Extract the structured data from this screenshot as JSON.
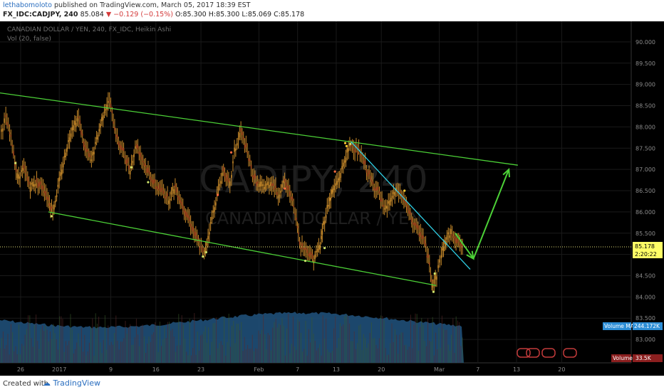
{
  "header": {
    "author": "lethabomoloto",
    "published_text": "published on TradingView.com, March 05, 2017 18:39 EST",
    "symbol": "FX_IDC:CADJPY, 240",
    "last": "85.084",
    "change": "−0.129 (−0.15%)",
    "ohlc": "O:85.300 H:85.300 L:85.069 C:85.178"
  },
  "chart_data": {
    "type": "line",
    "title": "CANADIAN DOLLAR / YEN, 240, FX_IDC, Heikin Ashi",
    "subtitle": "Vol (20, false)",
    "watermark": "CADJPY, 240",
    "watermark_sub": "CANADIAN DOLLAR / YEN",
    "ylim": [
      82.55,
      90.25
    ],
    "yticks": [
      "83.000",
      "83.500",
      "84.000",
      "84.500",
      "85.000",
      "85.500",
      "86.000",
      "86.500",
      "87.000",
      "87.500",
      "88.000",
      "88.500",
      "89.000",
      "89.500",
      "90.000"
    ],
    "xticks": [
      {
        "label": "26",
        "day": -6
      },
      {
        "label": "2017",
        "day": 0
      },
      {
        "label": "9",
        "day": 8
      },
      {
        "label": "16",
        "day": 15
      },
      {
        "label": "23",
        "day": 22
      },
      {
        "label": "Feb",
        "day": 31
      },
      {
        "label": "7",
        "day": 37
      },
      {
        "label": "13",
        "day": 43
      },
      {
        "label": "20",
        "day": 50
      },
      {
        "label": "Mar",
        "day": 59
      },
      {
        "label": "7",
        "day": 65
      },
      {
        "label": "13",
        "day": 71
      },
      {
        "label": "20",
        "day": 78
      }
    ],
    "xlim_days": [
      -9.2,
      88.8
    ],
    "price_path": [
      [
        -9,
        87.9
      ],
      [
        -8.3,
        88.2
      ],
      [
        -7.3,
        87.6
      ],
      [
        -6.5,
        86.8
      ],
      [
        -5.5,
        87.0
      ],
      [
        -4.5,
        86.6
      ],
      [
        -3.5,
        86.7
      ],
      [
        -2.5,
        86.6
      ],
      [
        -1.7,
        86.3
      ],
      [
        -1,
        86.0
      ],
      [
        0,
        86.7
      ],
      [
        1,
        87.4
      ],
      [
        2,
        88.0
      ],
      [
        3,
        88.2
      ],
      [
        4,
        87.5
      ],
      [
        5,
        87.2
      ],
      [
        6,
        87.8
      ],
      [
        7,
        88.4
      ],
      [
        7.8,
        88.6
      ],
      [
        9,
        87.7
      ],
      [
        10,
        87.4
      ],
      [
        11,
        87.0
      ],
      [
        12,
        87.6
      ],
      [
        13,
        87.2
      ],
      [
        14,
        86.9
      ],
      [
        15,
        86.6
      ],
      [
        16,
        86.5
      ],
      [
        17,
        86.3
      ],
      [
        18,
        86.6
      ],
      [
        19,
        86.2
      ],
      [
        20,
        85.9
      ],
      [
        21,
        85.5
      ],
      [
        21.8,
        85.2
      ],
      [
        22.5,
        85.0
      ],
      [
        23.5,
        85.7
      ],
      [
        24.5,
        86.4
      ],
      [
        25.5,
        87.0
      ],
      [
        26.5,
        86.6
      ],
      [
        27.2,
        87.4
      ],
      [
        28.2,
        87.9
      ],
      [
        29,
        87.5
      ],
      [
        30,
        86.9
      ],
      [
        31,
        86.6
      ],
      [
        32,
        86.6
      ],
      [
        33,
        86.7
      ],
      [
        34,
        86.4
      ],
      [
        35,
        86.7
      ],
      [
        36,
        86.4
      ],
      [
        36.8,
        85.8
      ],
      [
        37.5,
        85.2
      ],
      [
        38.5,
        85.1
      ],
      [
        39.5,
        84.9
      ],
      [
        40.5,
        85.2
      ],
      [
        41,
        85.7
      ],
      [
        41.8,
        86.2
      ],
      [
        42.5,
        86.5
      ],
      [
        43.5,
        86.8
      ],
      [
        44.5,
        87.3
      ],
      [
        45.3,
        87.6
      ],
      [
        46.5,
        87.4
      ],
      [
        47.5,
        87.1
      ],
      [
        48.5,
        86.7
      ],
      [
        49.5,
        86.5
      ],
      [
        50.5,
        86.0
      ],
      [
        51.5,
        86.3
      ],
      [
        52.5,
        86.5
      ],
      [
        53.5,
        86.3
      ],
      [
        54.5,
        85.9
      ],
      [
        55.5,
        85.6
      ],
      [
        56.5,
        85.4
      ],
      [
        57.3,
        84.9
      ],
      [
        58,
        84.3
      ],
      [
        58.6,
        84.5
      ],
      [
        59.3,
        85.0
      ],
      [
        60.2,
        85.4
      ],
      [
        61,
        85.5
      ],
      [
        62,
        85.3
      ],
      [
        62.8,
        85.1
      ]
    ],
    "dots": [
      {
        "day": -6.8,
        "price": 87.15,
        "color": "#cde36a"
      },
      {
        "day": -1.2,
        "price": 85.9,
        "color": "#cde36a"
      },
      {
        "day": 11.2,
        "price": 87.05,
        "color": "#cde36a"
      },
      {
        "day": 13.8,
        "price": 86.7,
        "color": "#cde36a"
      },
      {
        "day": 26.7,
        "price": 87.4,
        "color": "#ff6a3d"
      },
      {
        "day": 24.6,
        "price": 86.4,
        "color": "#ff6a3d"
      },
      {
        "day": 22.8,
        "price": 85.05,
        "color": "#cde36a"
      },
      {
        "day": 22.3,
        "price": 84.95,
        "color": "#cde36a"
      },
      {
        "day": 41.2,
        "price": 85.15,
        "color": "#cde36a"
      },
      {
        "day": 38.2,
        "price": 84.85,
        "color": "#cde36a"
      },
      {
        "day": 44.4,
        "price": 87.62,
        "color": "#ffcc33"
      },
      {
        "day": 45.2,
        "price": 87.6,
        "color": "#cde36a"
      },
      {
        "day": 44.6,
        "price": 87.55,
        "color": "#ffcc33"
      },
      {
        "day": 35.0,
        "price": 86.55,
        "color": "#ff6a3d"
      },
      {
        "day": 42.8,
        "price": 86.95,
        "color": "#ff6a3d"
      },
      {
        "day": 58.3,
        "price": 84.55,
        "color": "#cde36a"
      },
      {
        "day": 58.1,
        "price": 84.12,
        "color": "#cde36a"
      },
      {
        "day": 53.6,
        "price": 86.5,
        "color": "#ffcc33"
      }
    ],
    "lines": [
      {
        "from": [
          -9.2,
          88.8
        ],
        "to": [
          71.2,
          87.1
        ],
        "color": "#4cd137"
      },
      {
        "from": [
          -1.7,
          86.0
        ],
        "to": [
          58.5,
          84.27
        ],
        "color": "#4cd137"
      },
      {
        "from": [
          45.3,
          87.65
        ],
        "to": [
          63.8,
          84.65
        ],
        "color": "#2fd0e6"
      },
      {
        "from": [
          61.5,
          85.5
        ],
        "to": [
          64.3,
          84.9
        ],
        "color": "#4cd137",
        "arrow": true
      },
      {
        "from": [
          64.3,
          84.9
        ],
        "to": [
          69.8,
          87.0
        ],
        "color": "#4cd137",
        "arrow": true
      }
    ],
    "current_price": {
      "value": 85.178,
      "label": "85.178",
      "countdown": "2:20:22"
    },
    "volume": {
      "ma_label": "Volume MA",
      "ma_value": "244.172K",
      "vol_label": "Volume",
      "vol_value": "33.5K",
      "area_color": "#1f4f78"
    },
    "colors": {
      "background": "#000000",
      "candle": "#c88a2a",
      "axis_text": "#8a8a8a",
      "grid": "#1a1a1a"
    }
  },
  "footer": {
    "created_with": "Created with",
    "brand": "TradingView"
  }
}
